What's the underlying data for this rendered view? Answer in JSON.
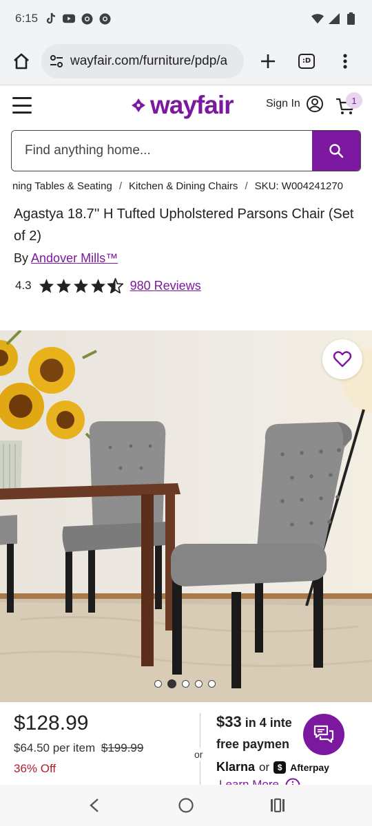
{
  "status_bar": {
    "time": "6:15"
  },
  "browser": {
    "url": "wayfair.com/furniture/pdp/a",
    "tab_count": ":D"
  },
  "header": {
    "logo_text": "wayfair",
    "sign_in_label": "Sign In",
    "cart_count": "1"
  },
  "search": {
    "placeholder": "Find anything home..."
  },
  "breadcrumb": {
    "items": [
      "ning Tables & Seating",
      "Kitchen & Dining Chairs",
      "SKU: W004241270"
    ],
    "separator": "/"
  },
  "product": {
    "title": "Agastya 18.7'' H Tufted Upholstered Parsons Chair (Set of 2)",
    "by_prefix": "By",
    "brand": "Andover Mills™",
    "rating": "4.3",
    "stars_value": 4.3,
    "reviews_label": "980 Reviews"
  },
  "carousel": {
    "total": 5,
    "active_index": 1
  },
  "pricing": {
    "price": "$128.99",
    "per_item": "$64.50 per item",
    "was_price": "$199.99",
    "discount": "36% Off",
    "or_label": "or",
    "installment_amount": "$33",
    "installment_text": " in 4 inte",
    "installment_line2": "free paymen",
    "installment_line2_end": "n",
    "klarna": "Klarna",
    "pay_or": "or",
    "afterpay_glyph": "$",
    "afterpay": "Afterpay",
    "learn_more": "Learn More"
  },
  "colors": {
    "brand": "#7b189f",
    "discount": "#b11c2f"
  },
  "icons": {
    "home": "home-icon",
    "tune": "tune-icon",
    "plus": "plus-icon",
    "more": "more-vert-icon",
    "menu": "hamburger-icon",
    "account": "account-icon",
    "cart": "cart-icon",
    "search": "search-icon",
    "heart": "heart-icon",
    "chat": "chat-icon",
    "back": "back-icon",
    "home_nav": "home-circle-icon",
    "recents": "recents-icon"
  }
}
